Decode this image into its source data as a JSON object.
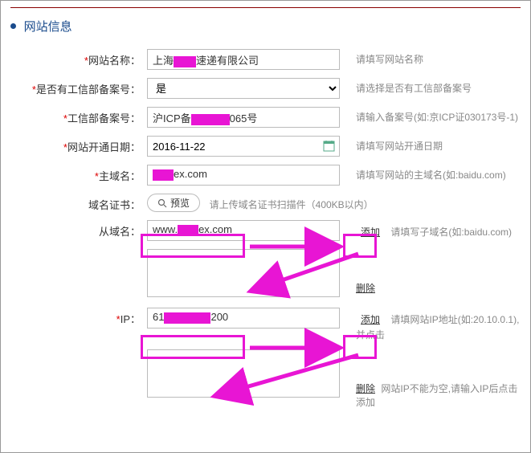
{
  "section": {
    "title": "网站信息"
  },
  "fields": {
    "siteName": {
      "label": "网站名称：",
      "value_pre": "上海",
      "value_post": "速递有限公司",
      "hint": "请填写网站名称"
    },
    "hasRecord": {
      "label": "是否有工信部备案号：",
      "value": "是",
      "hint": "请选择是否有工信部备案号"
    },
    "recordNo": {
      "label": "工信部备案号：",
      "value_pre": "沪ICP备",
      "value_post": "065号",
      "hint": "请输入备案号(如:京ICP证030173号-1)"
    },
    "openDate": {
      "label": "网站开通日期：",
      "value": "2016-11-22",
      "hint": "请填写网站开通日期"
    },
    "mainDomain": {
      "label": "主域名：",
      "value_post": "ex.com",
      "hint": "请填写网站的主域名(如:baidu.com)"
    },
    "cert": {
      "label": "域名证书：",
      "preview": "预览",
      "hint": "请上传域名证书扫描件（400KB以内）"
    },
    "subDomain": {
      "label": "从域名：",
      "value_pre": "www.",
      "value_post": "ex.com",
      "add": "添加",
      "del": "删除",
      "hint": "请填写子域名(如:baidu.com)"
    },
    "ip": {
      "label": "IP：",
      "value_pre": "61",
      "value_post": "200",
      "add": "添加",
      "del": "删除",
      "hint": "请填网站IP地址(如:20.10.0.1),并点击",
      "hint2": "网站IP不能为空,请输入IP后点击添加"
    }
  }
}
